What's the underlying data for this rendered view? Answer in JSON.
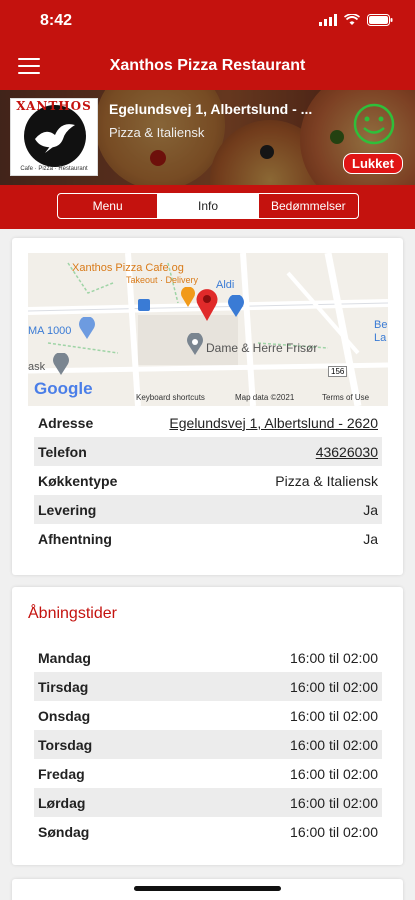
{
  "status_bar": {
    "time": "8:42"
  },
  "header": {
    "title": "Xanthos Pizza Restaurant"
  },
  "restaurant": {
    "name": "Egelundsvej 1, Albertslund - ...",
    "category": "Pizza & Italiensk",
    "status_label": "Lukket",
    "logo_word": "XANTHOS",
    "logo_sub": "Cafe · Pizza · Restaurant"
  },
  "tabs": [
    {
      "label": "Menu"
    },
    {
      "label": "Info"
    },
    {
      "label": "Bedømmelser"
    }
  ],
  "map": {
    "labels": {
      "place": "Xanthos Pizza Cafe og",
      "place_sub": "Takeout · Delivery",
      "aldi": "Aldi",
      "hair": "Dame & Herre Frisør",
      "ma": "MA 1000",
      "ask": "ask",
      "be": "Be",
      "la": "La",
      "road": "156",
      "google": "Google"
    },
    "footer": {
      "shortcuts": "Keyboard shortcuts",
      "data": "Map data ©2021",
      "terms": "Terms of Use"
    }
  },
  "info_rows": [
    {
      "key": "Adresse",
      "value": "Egelundsvej 1, Albertslund - 2620"
    },
    {
      "key": "Telefon",
      "value": "43626030"
    },
    {
      "key": "Køkkentype",
      "value": "Pizza & Italiensk"
    },
    {
      "key": "Levering",
      "value": "Ja"
    },
    {
      "key": "Afhentning",
      "value": "Ja"
    }
  ],
  "hours": {
    "title": "Åbningstider",
    "rows": [
      {
        "day": "Mandag",
        "time": "16:00 til 02:00"
      },
      {
        "day": "Tirsdag",
        "time": "16:00 til 02:00"
      },
      {
        "day": "Onsdag",
        "time": "16:00 til 02:00"
      },
      {
        "day": "Torsdag",
        "time": "16:00 til 02:00"
      },
      {
        "day": "Fredag",
        "time": "16:00 til 02:00"
      },
      {
        "day": "Lørdag",
        "time": "16:00 til 02:00"
      },
      {
        "day": "Søndag",
        "time": "16:00 til 02:00"
      }
    ]
  },
  "colors": {
    "brand_red": "#c4120e",
    "closed_badge": "#e01515",
    "smiley_green": "#2fbf3a"
  }
}
